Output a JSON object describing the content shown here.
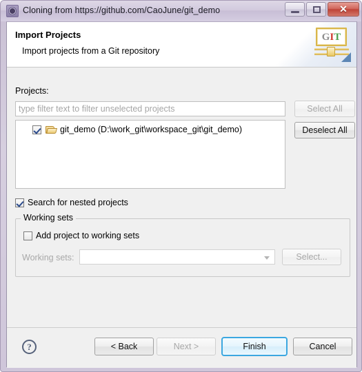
{
  "window": {
    "title": "Cloning from https://github.com/CaoJune/git_demo",
    "icon": "git-clone-icon",
    "controls": {
      "minimize": "minimize-icon",
      "maximize": "maximize-icon",
      "close": "✕"
    }
  },
  "header": {
    "title": "Import Projects",
    "subtitle": "Import projects from a Git repository",
    "logo": {
      "g": "G",
      "i": "I",
      "t": "T"
    }
  },
  "body": {
    "projects_label": "Projects:",
    "filter": {
      "value": "",
      "placeholder": "type filter text to filter unselected projects"
    },
    "select_all_label": "Select All",
    "deselect_all_label": "Deselect All",
    "projects": [
      {
        "checked": true,
        "name": "git_demo (D:\\work_git\\workspace_git\\git_demo)"
      }
    ],
    "nested_projects_label": "Search for nested projects",
    "working_sets": {
      "group_title": "Working sets",
      "add_project_label": "Add project to working sets",
      "working_sets_label": "Working sets:",
      "combo_value": "",
      "select_label": "Select..."
    }
  },
  "footer": {
    "help_label": "?",
    "back_label": "< Back",
    "next_label": "Next >",
    "finish_label": "Finish",
    "cancel_label": "Cancel"
  },
  "colors": {
    "accent_blue": "#3ba7e0",
    "titlebar": "#d2cade",
    "body_bg": "#f0f0f0",
    "close_red": "#bf4338"
  }
}
